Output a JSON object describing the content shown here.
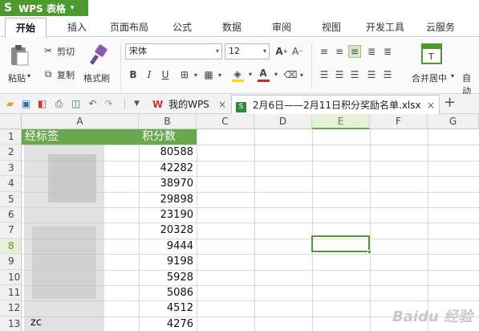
{
  "app": {
    "name": "WPS 表格",
    "accent": "#4e9a2e"
  },
  "menu": {
    "tabs": [
      "开始",
      "插入",
      "页面布局",
      "公式",
      "数据",
      "审阅",
      "视图",
      "开发工具",
      "云服务"
    ],
    "active": "开始"
  },
  "ribbon": {
    "paste_label": "粘贴",
    "cut_label": "剪切",
    "copy_label": "复制",
    "format_painter_label": "格式刷",
    "font_name": "宋体",
    "font_size": "12",
    "merge_center_label": "合并居中",
    "auto_wrap_label": "自动"
  },
  "doc_tabs": {
    "home": "我的WPS",
    "file": "2月6日——2月11日积分奖励名单.xlsx"
  },
  "sheet": {
    "columns": [
      "A",
      "B",
      "C",
      "D",
      "E",
      "F",
      "G"
    ],
    "selected_column": "E",
    "rows": [
      "1",
      "2",
      "3",
      "4",
      "5",
      "6",
      "7",
      "8",
      "9",
      "10",
      "11",
      "12",
      "13"
    ],
    "selected_row": "8",
    "header_a": "经标签",
    "header_b": "积分数",
    "b_values": [
      "80588",
      "42282",
      "38970",
      "29898",
      "23190",
      "20328",
      "9444",
      "9198",
      "5928",
      "5086",
      "4512",
      "4276"
    ],
    "a13_partial": "zc"
  },
  "watermark": "Baidu 经验"
}
